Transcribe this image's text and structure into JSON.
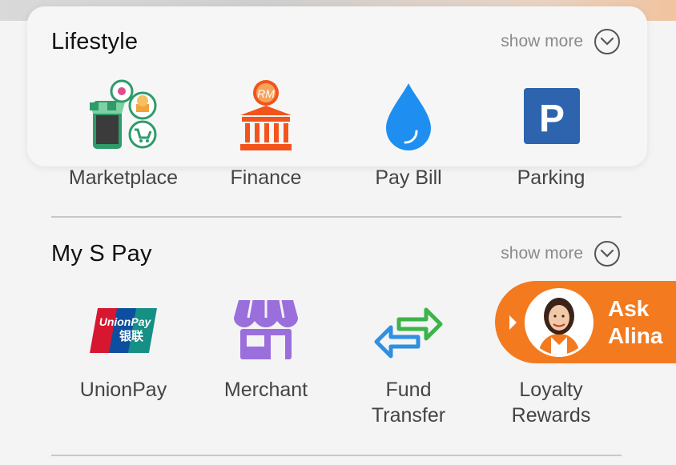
{
  "lifestyle": {
    "title": "Lifestyle",
    "show_more": "show more",
    "items": [
      {
        "label": "Marketplace",
        "icon": "marketplace-icon"
      },
      {
        "label": "Finance",
        "icon": "finance-bank-icon"
      },
      {
        "label": "Pay Bill",
        "icon": "water-drop-icon"
      },
      {
        "label": "Parking",
        "icon": "parking-icon"
      }
    ]
  },
  "my_s_pay": {
    "title": "My S Pay",
    "show_more": "show more",
    "items": [
      {
        "label": "UnionPay",
        "icon": "unionpay-icon"
      },
      {
        "label": "Merchant",
        "icon": "merchant-store-icon"
      },
      {
        "label": "Fund Transfer",
        "line1": "Fund",
        "line2": "Transfer",
        "icon": "fund-transfer-icon"
      },
      {
        "label": "Loyalty Rewards",
        "line1": "Loyalty",
        "line2": "Rewards",
        "icon": "loyalty-rewards-icon"
      }
    ]
  },
  "assistant": {
    "line1": "Ask",
    "line2": "Alina"
  },
  "icon_text": {
    "finance_badge": "RM",
    "parking_letter": "P",
    "unionpay_brand": "UnionPay",
    "unionpay_cn": "银联"
  },
  "colors": {
    "accent_orange": "#f47a1f",
    "marketplace_green": "#2e9b6a",
    "finance_orange": "#f2541b",
    "paybill_blue": "#1e8ff0",
    "parking_blue": "#2d64ad",
    "merchant_purple": "#9a6fdc",
    "transfer_green": "#3cb44a",
    "transfer_blue": "#2f8fe0"
  }
}
